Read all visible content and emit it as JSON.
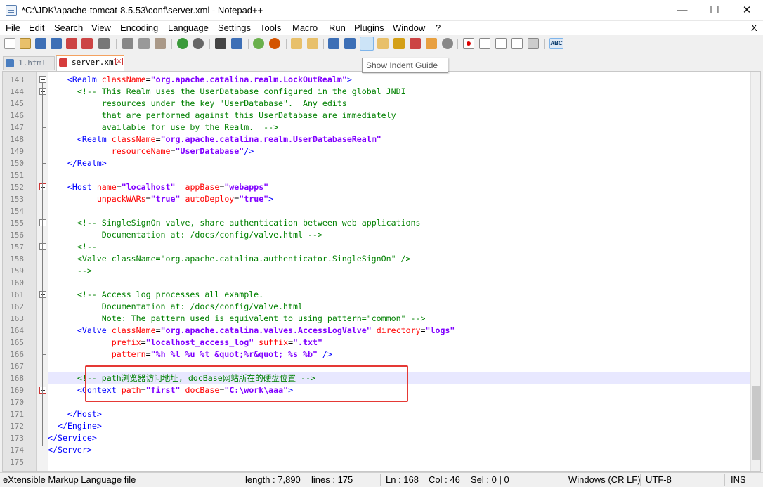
{
  "window": {
    "title": "*C:\\JDK\\apache-tomcat-8.5.53\\conf\\server.xml - Notepad++"
  },
  "menu": [
    "File",
    "Edit",
    "Search",
    "View",
    "Encoding",
    "Language",
    "Settings",
    "Tools",
    "Macro",
    "Run",
    "Plugins",
    "Window",
    "?"
  ],
  "menu_close": "X",
  "tooltip": "Show Indent Guide",
  "tabs": [
    {
      "label": "1.html",
      "active": false
    },
    {
      "label": "server.xml",
      "active": true
    }
  ],
  "editor": {
    "current_line": "168",
    "lines": [
      {
        "n": "143",
        "code": "    <Realm className=\"org.apache.catalina.realm.LockOutRealm\">"
      },
      {
        "n": "144",
        "code": "      <!-- This Realm uses the UserDatabase configured in the global JNDI"
      },
      {
        "n": "145",
        "code": "           resources under the key \"UserDatabase\".  Any edits"
      },
      {
        "n": "146",
        "code": "           that are performed against this UserDatabase are immediately"
      },
      {
        "n": "147",
        "code": "           available for use by the Realm.  -->"
      },
      {
        "n": "148",
        "code": "      <Realm className=\"org.apache.catalina.realm.UserDatabaseRealm\""
      },
      {
        "n": "149",
        "code": "             resourceName=\"UserDatabase\"/>"
      },
      {
        "n": "150",
        "code": "    </Realm>"
      },
      {
        "n": "151",
        "code": ""
      },
      {
        "n": "152",
        "code": "    <Host name=\"localhost\"  appBase=\"webapps\""
      },
      {
        "n": "153",
        "code": "          unpackWARs=\"true\" autoDeploy=\"true\">"
      },
      {
        "n": "154",
        "code": ""
      },
      {
        "n": "155",
        "code": "      <!-- SingleSignOn valve, share authentication between web applications"
      },
      {
        "n": "156",
        "code": "           Documentation at: /docs/config/valve.html -->"
      },
      {
        "n": "157",
        "code": "      <!--"
      },
      {
        "n": "158",
        "code": "      <Valve className=\"org.apache.catalina.authenticator.SingleSignOn\" />"
      },
      {
        "n": "159",
        "code": "      -->"
      },
      {
        "n": "160",
        "code": ""
      },
      {
        "n": "161",
        "code": "      <!-- Access log processes all example."
      },
      {
        "n": "162",
        "code": "           Documentation at: /docs/config/valve.html"
      },
      {
        "n": "163",
        "code": "           Note: The pattern used is equivalent to using pattern=\"common\" -->"
      },
      {
        "n": "164",
        "code": "      <Valve className=\"org.apache.catalina.valves.AccessLogValve\" directory=\"logs\""
      },
      {
        "n": "165",
        "code": "             prefix=\"localhost_access_log\" suffix=\".txt\""
      },
      {
        "n": "166",
        "code": "             pattern=\"%h %l %u %t &quot;%r&quot; %s %b\" />"
      },
      {
        "n": "167",
        "code": ""
      },
      {
        "n": "168",
        "code": "      <!-- path浏览器访问地址, docBase网站所在的硬盘位置 -->"
      },
      {
        "n": "169",
        "code": "      <Context path=\"first\" docBase=\"C:\\work\\aaa\">"
      },
      {
        "n": "170",
        "code": ""
      },
      {
        "n": "171",
        "code": "    </Host>"
      },
      {
        "n": "172",
        "code": "  </Engine>"
      },
      {
        "n": "173",
        "code": "</Service>"
      },
      {
        "n": "174",
        "code": "</Server>"
      },
      {
        "n": "175",
        "code": ""
      }
    ]
  },
  "status": {
    "filetype": "eXtensible Markup Language file",
    "length": "length : 7,890",
    "lines": "lines : 175",
    "ln": "Ln : 168",
    "col": "Col : 46",
    "sel": "Sel : 0 | 0",
    "eol": "Windows (CR LF)",
    "encoding": "UTF-8",
    "mode": "INS"
  },
  "colors": {
    "tag": "#0000ff",
    "attr": "#ff0000",
    "value": "#8000ff",
    "comment": "#008000",
    "highlight_box": "#e53935",
    "current_line": "#e8e8ff"
  }
}
